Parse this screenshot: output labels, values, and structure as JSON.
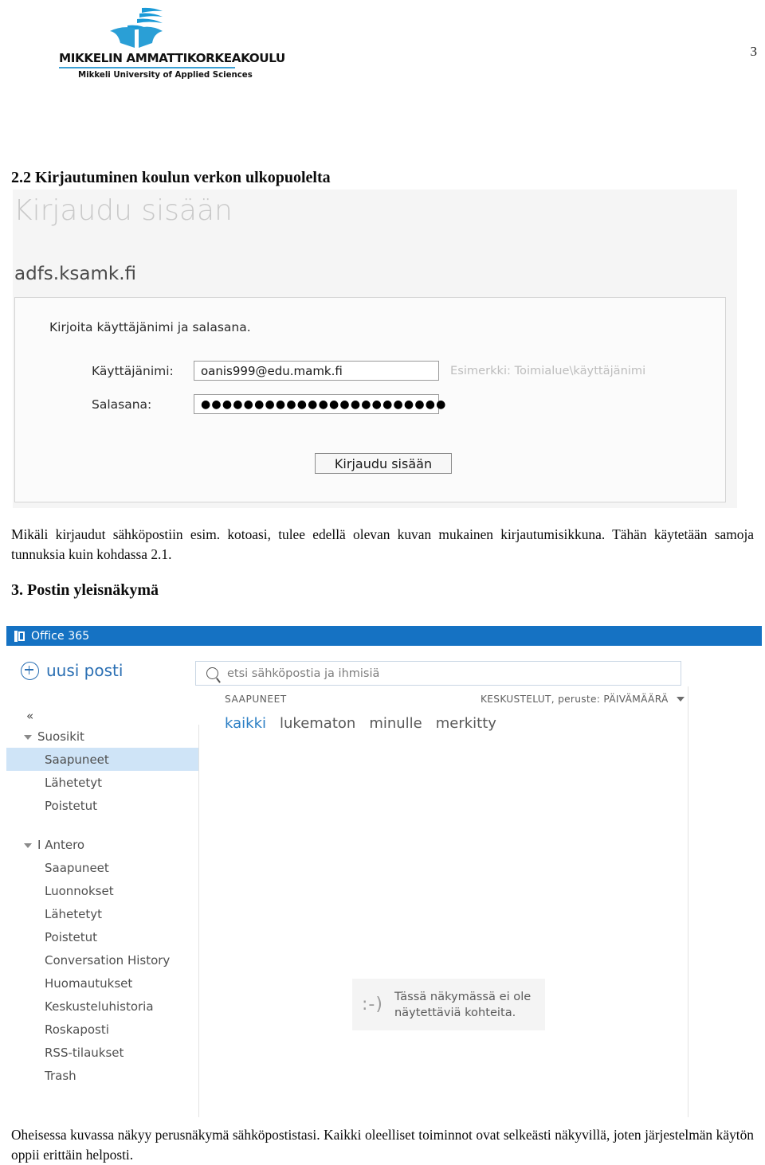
{
  "document": {
    "page_number": "3",
    "logo": {
      "mark": "mamk-wave-logo",
      "wordmark": "MIKKELIN AMMATTIKORKEAKOULU",
      "subtitle": "Mikkeli University of Applied Sciences",
      "accent_color": "#3b9fd4"
    },
    "headings": {
      "section_22": "2.2 Kirjautuminen koulun verkon ulkopuolelta",
      "section_3": "3. Postin yleisnäkymä"
    },
    "paragraphs": {
      "after_login_shot": "Mikäli kirjaudut sähköpostiin esim. kotoasi, tulee edellä olevan kuvan mukainen kirjautumisikkuna. Tähän käytetään samoja tunnuksia kuin kohdassa 2.1.",
      "after_owa_shot": "Oheisessa kuvassa näkyy perusnäkymä sähköpostistasi. Kaikki oleelliset toiminnot ovat selkeästi näkyvillä, joten järjestelmän käytön oppii erittäin helposti."
    }
  },
  "adfs_login": {
    "title": "Kirjaudu sisään",
    "domain": "adfs.ksamk.fi",
    "prompt": "Kirjoita käyttäjänimi ja salasana.",
    "username_label": "Käyttäjänimi:",
    "username_value": "oanis999@edu.mamk.fi",
    "username_hint": "Esimerkki: Toimialue\\käyttäjänimi",
    "password_label": "Salasana:",
    "password_value": "●●●●●●●●●●●●●●●●●●●●●●●",
    "submit_label": "Kirjaudu sisään"
  },
  "owa": {
    "suite_bar": {
      "brand": "Office 365",
      "brand_color": "#1572c3",
      "logo_icon": "office-tile-icon"
    },
    "new_mail_label": "uusi posti",
    "search": {
      "placeholder": "etsi sähköpostia ja ihmisiä",
      "icon": "search-icon"
    },
    "collapse_label": "«",
    "sidebar": {
      "favorites": {
        "group_label": "Suosikit",
        "items": [
          {
            "label": "Saapuneet",
            "selected": true
          },
          {
            "label": "Lähetetyt",
            "selected": false
          },
          {
            "label": "Poistetut",
            "selected": false
          }
        ]
      },
      "mailbox": {
        "group_label": "I Antero",
        "items": [
          {
            "label": "Saapuneet",
            "selected": false
          },
          {
            "label": "Luonnokset",
            "selected": false
          },
          {
            "label": "Lähetetyt",
            "selected": false
          },
          {
            "label": "Poistetut",
            "selected": false
          },
          {
            "label": "Conversation History",
            "selected": false
          },
          {
            "label": "Huomautukset",
            "selected": false
          },
          {
            "label": "Keskusteluhistoria",
            "selected": false
          },
          {
            "label": "Roskaposti",
            "selected": false
          },
          {
            "label": "RSS-tilaukset",
            "selected": false
          },
          {
            "label": "Trash",
            "selected": false
          }
        ]
      }
    },
    "list_pane": {
      "folder_title": "SAAPUNEET",
      "sort_label": "KESKUSTELUT, peruste: PÄIVÄMÄÄRÄ",
      "sort_icon": "chevron-down-icon",
      "filters": [
        {
          "label": "kaikki",
          "active": true
        },
        {
          "label": "lukematon",
          "active": false
        },
        {
          "label": "minulle",
          "active": false
        },
        {
          "label": "merkitty",
          "active": false
        }
      ]
    },
    "reading_pane": {
      "empty_face": ":-)",
      "empty_message": "Tässä näkymässä ei ole näytettäviä kohteita."
    }
  }
}
